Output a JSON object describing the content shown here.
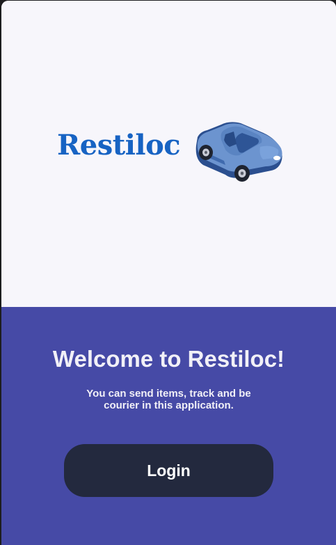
{
  "app": {
    "logo_text": "Restiloc",
    "logo_color": "#1763c3",
    "accent_color": "#464aa6",
    "button_color": "#23293e",
    "illustration_icon": "car-icon"
  },
  "welcome": {
    "title": "Welcome to Restiloc!",
    "subtitle": "You can send items, track and be courier in this application."
  },
  "actions": {
    "login_label": "Login"
  }
}
